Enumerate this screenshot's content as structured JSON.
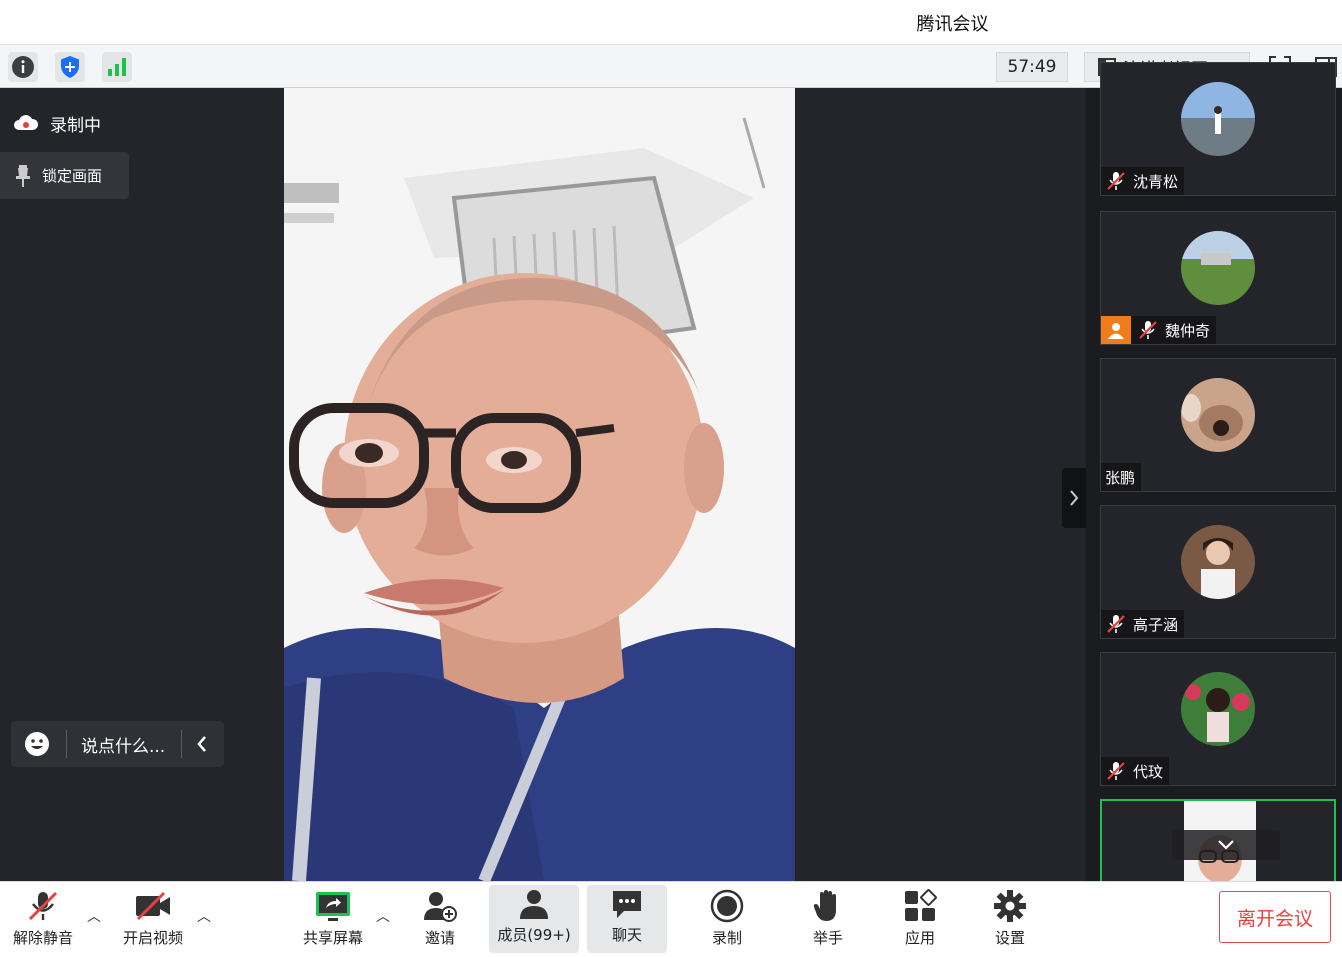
{
  "window": {
    "title": "腾讯会议"
  },
  "topbar": {
    "timer": "57:49",
    "view_label": "演讲者视图"
  },
  "overlay": {
    "recording_label": "录制中",
    "lock_label": "锁定画面",
    "chat_placeholder": "说点什么..."
  },
  "participants": [
    {
      "name": "沈青松",
      "muted": true
    },
    {
      "name": "魏仲奇",
      "muted": true,
      "host": true
    },
    {
      "name": "张鹏",
      "muted": false
    },
    {
      "name": "高子涵",
      "muted": true
    },
    {
      "name": "代玟",
      "muted": true
    }
  ],
  "bottombar": {
    "unmute": "解除静音",
    "start_video": "开启视频",
    "share_screen": "共享屏幕",
    "invite": "邀请",
    "members": "成员(99+)",
    "chat": "聊天",
    "record": "录制",
    "raise_hand": "举手",
    "apps": "应用",
    "settings": "设置",
    "leave": "离开会议"
  },
  "colors": {
    "accent_green": "#1ec050",
    "accent_blue": "#1a6ef5",
    "danger_red": "#e8403f",
    "host_orange": "#f07d1a"
  }
}
